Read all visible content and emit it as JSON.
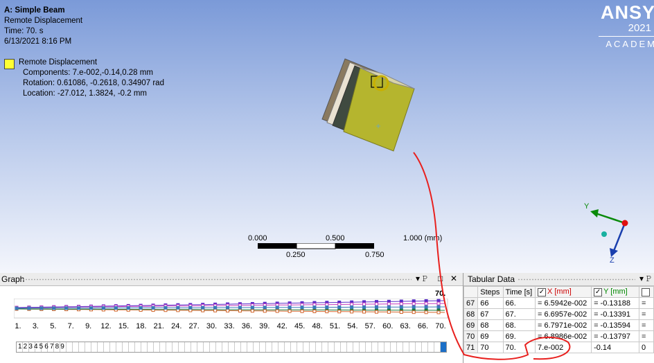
{
  "viewport": {
    "info": {
      "title": "A: Simple Beam",
      "object": "Remote Displacement",
      "time": "Time: 70. s",
      "date": "6/13/2021 8:16 PM"
    },
    "legend": {
      "name": "Remote Displacement",
      "components": "Components: 7.e-002,-0.14,0.28 mm",
      "rotation": "Rotation: 0.61086, -0.2618, 0.34907 rad",
      "location": "Location: -27.012, 1.3824, -0.2 mm",
      "swatch_color": "#ffff33"
    },
    "logo": {
      "brand": "ANSY",
      "year": "2021",
      "edition": "ACADEM"
    },
    "scale": {
      "t0": "0.000",
      "t1": "0.500",
      "t2": "1.000 (mm)",
      "b1": "0.250",
      "b2": "0.750"
    },
    "triad": {
      "y": "Y",
      "z": "Z"
    }
  },
  "graph": {
    "title": "Graph",
    "current": "70.",
    "ticks": [
      "1.",
      "3.",
      "5.",
      "7.",
      "9.",
      "12.",
      "15.",
      "18.",
      "21.",
      "24.",
      "27.",
      "30.",
      "33.",
      "36.",
      "39.",
      "42.",
      "45.",
      "48.",
      "51.",
      "54.",
      "57.",
      "60.",
      "63.",
      "66.",
      "70."
    ],
    "steps_numbers": "123456789",
    "controls": {
      "pin": "▾ ȩ",
      "max": "□",
      "close": "✕"
    }
  },
  "tabular": {
    "title": "Tabular Data",
    "headers": [
      "Steps",
      "Time [s]",
      "X [mm]",
      "Y [mm]"
    ],
    "rows": [
      {
        "n": "67",
        "step": "66",
        "time": "66.",
        "x": "= 6.5942e-002",
        "y": "= -0.13188",
        "z": "="
      },
      {
        "n": "68",
        "step": "67",
        "time": "67.",
        "x": "= 6.6957e-002",
        "y": "= -0.13391",
        "z": "="
      },
      {
        "n": "69",
        "step": "68",
        "time": "68.",
        "x": "= 6.7971e-002",
        "y": "= -0.13594",
        "z": "="
      },
      {
        "n": "70",
        "step": "69",
        "time": "69.",
        "x": "= 6.8986e-002",
        "y": "= -0.13797",
        "z": "="
      },
      {
        "n": "71",
        "step": "70",
        "time": "70.",
        "x": "7.e-002",
        "y": "-0.14",
        "z": "0"
      }
    ]
  },
  "colors": {
    "annotation": "#e8201e",
    "block_face": "#b5b52e",
    "bar_blue": "#1b6fc7"
  }
}
